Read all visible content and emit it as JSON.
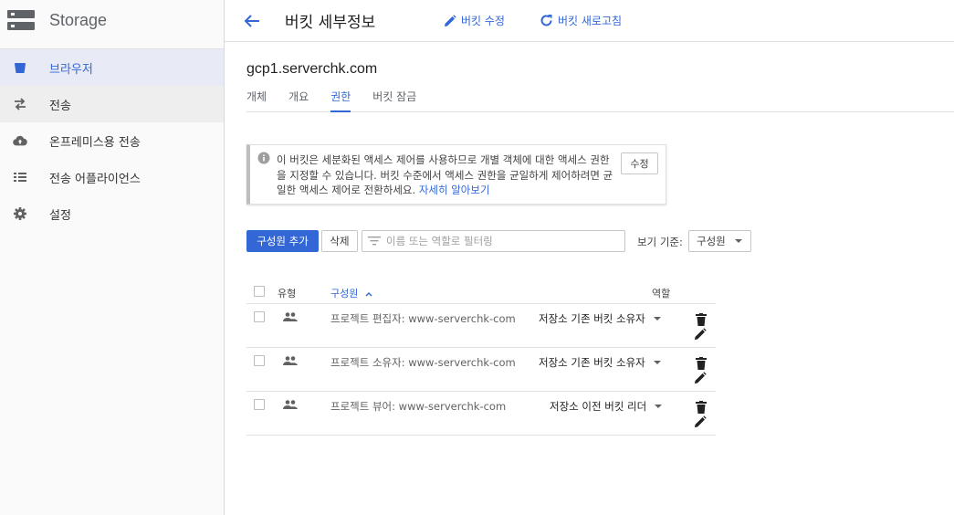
{
  "sidebar": {
    "title": "Storage",
    "items": [
      {
        "label": "브라우저",
        "icon": "bucket-icon",
        "state": "active"
      },
      {
        "label": "전송",
        "icon": "transfer-arrows-icon",
        "state": "hover"
      },
      {
        "label": "온프레미스용 전송",
        "icon": "cloud-upload-icon",
        "state": "normal"
      },
      {
        "label": "전송 어플라이언스",
        "icon": "appliance-list-icon",
        "state": "normal"
      },
      {
        "label": "설정",
        "icon": "gear-icon",
        "state": "normal"
      }
    ]
  },
  "header": {
    "title": "버킷 세부정보",
    "edit_label": "버킷 수정",
    "refresh_label": "버킷 새로고침"
  },
  "bucket": {
    "name": "gcp1.serverchk.com"
  },
  "tabs": [
    {
      "label": "개체",
      "active": false
    },
    {
      "label": "개요",
      "active": false
    },
    {
      "label": "권한",
      "active": true
    },
    {
      "label": "버킷 잠금",
      "active": false
    }
  ],
  "notice": {
    "text": "이 버킷은 세분화된 액세스 제어를 사용하므로 개별 객체에 대한 액세스 권한을 지정할 수 있습니다. 버킷 수준에서 액세스 권한을 균일하게 제어하려면 균일한 액세스 제어로 전환하세요.",
    "link": "자세히 알아보기",
    "edit_label": "수정"
  },
  "toolbar": {
    "add_label": "구성원 추가",
    "delete_label": "삭제",
    "filter_placeholder": "이름 또는 역할로 필터링",
    "view_by_label": "보기 기준:",
    "view_by_value": "구성원"
  },
  "table": {
    "headers": {
      "type": "유형",
      "member": "구성원",
      "role": "역할"
    },
    "rows": [
      {
        "member": "프로젝트 편집자: www-serverchk-com",
        "role": "저장소 기존 버킷 소유자"
      },
      {
        "member": "프로젝트 소유자: www-serverchk-com",
        "role": "저장소 기존 버킷 소유자"
      },
      {
        "member": "프로젝트 뷰어: www-serverchk-com",
        "role": "저장소 이전 버킷 리더"
      }
    ]
  },
  "colors": {
    "accent": "#3367d6",
    "sidebar_active_bg": "#e8eaf6"
  }
}
